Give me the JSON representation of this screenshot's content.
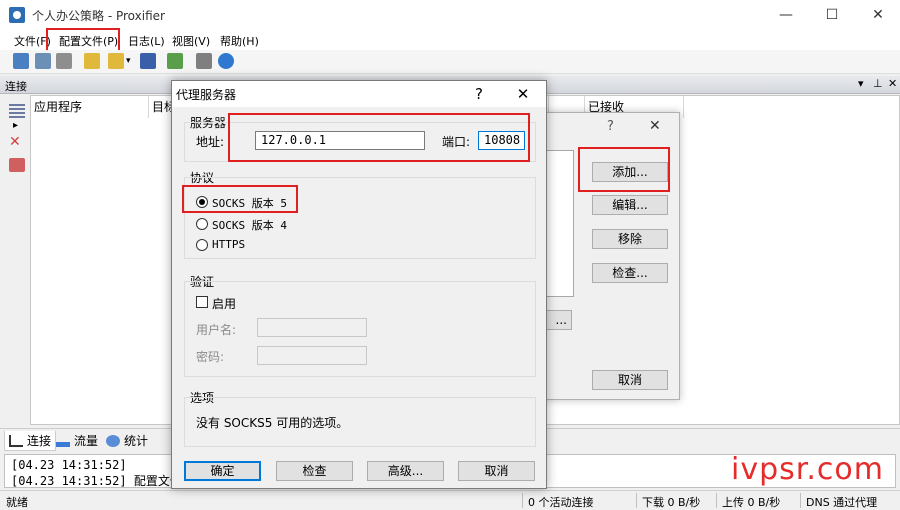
{
  "window": {
    "title": "个人办公策略 - Proxifier",
    "controls": {
      "minimize": "—",
      "maximize": "☐",
      "close": "✕"
    }
  },
  "menu": [
    "文件(F)",
    "配置文件(P)",
    "日志(L)",
    "视图(V)",
    "帮助(H)"
  ],
  "panel": {
    "title": "连接",
    "header_controls": {
      "dropdown": "▾",
      "pin": "⊥",
      "close": "✕"
    },
    "columns": [
      "应用程序",
      "目标",
      "",
      "",
      "已接收"
    ]
  },
  "tabs": [
    {
      "label": "连接",
      "icon": "connections-icon"
    },
    {
      "label": "流量",
      "icon": "traffic-icon"
    },
    {
      "label": "统计",
      "icon": "statistics-icon"
    }
  ],
  "log": [
    "[04.23 14:31:52]",
    "[04.23 14:31:52] 配置文件"
  ],
  "status": {
    "ready": "就绪",
    "active_connections": "0 个活动连接",
    "download": "下载 0 B/秒",
    "upload": "上传 0 B/秒",
    "dns": "DNS 通过代理"
  },
  "bg_dialog": {
    "controls": {
      "help": "?",
      "close": "✕"
    },
    "buttons": {
      "add": "添加...",
      "edit": "编辑...",
      "remove": "移除",
      "check": "检查...",
      "cancel": "取消",
      "partial": "..."
    }
  },
  "dialog": {
    "title": "代理服务器",
    "controls": {
      "help": "?",
      "close": "✕"
    },
    "server": {
      "group_label": "服务器",
      "address_label": "地址:",
      "address_value": "127.0.0.1",
      "port_label": "端口:",
      "port_value": "10808"
    },
    "protocol": {
      "group_label": "协议",
      "options": [
        "SOCKS 版本 5",
        "SOCKS 版本 4",
        "HTTPS"
      ],
      "selected": "SOCKS 版本 5"
    },
    "auth": {
      "group_label": "验证",
      "enable_label": "启用",
      "enabled": false,
      "username_label": "用户名:",
      "password_label": "密码:"
    },
    "options": {
      "group_label": "选项",
      "text": "没有 SOCKS5 可用的选项。"
    },
    "buttons": {
      "ok": "确定",
      "check": "检查",
      "advanced": "高级...",
      "cancel": "取消"
    }
  },
  "watermark": "ivpsr.com",
  "colors": {
    "highlight": "#e02020",
    "focus": "#0078d7",
    "watermark": "#e62b2b"
  }
}
